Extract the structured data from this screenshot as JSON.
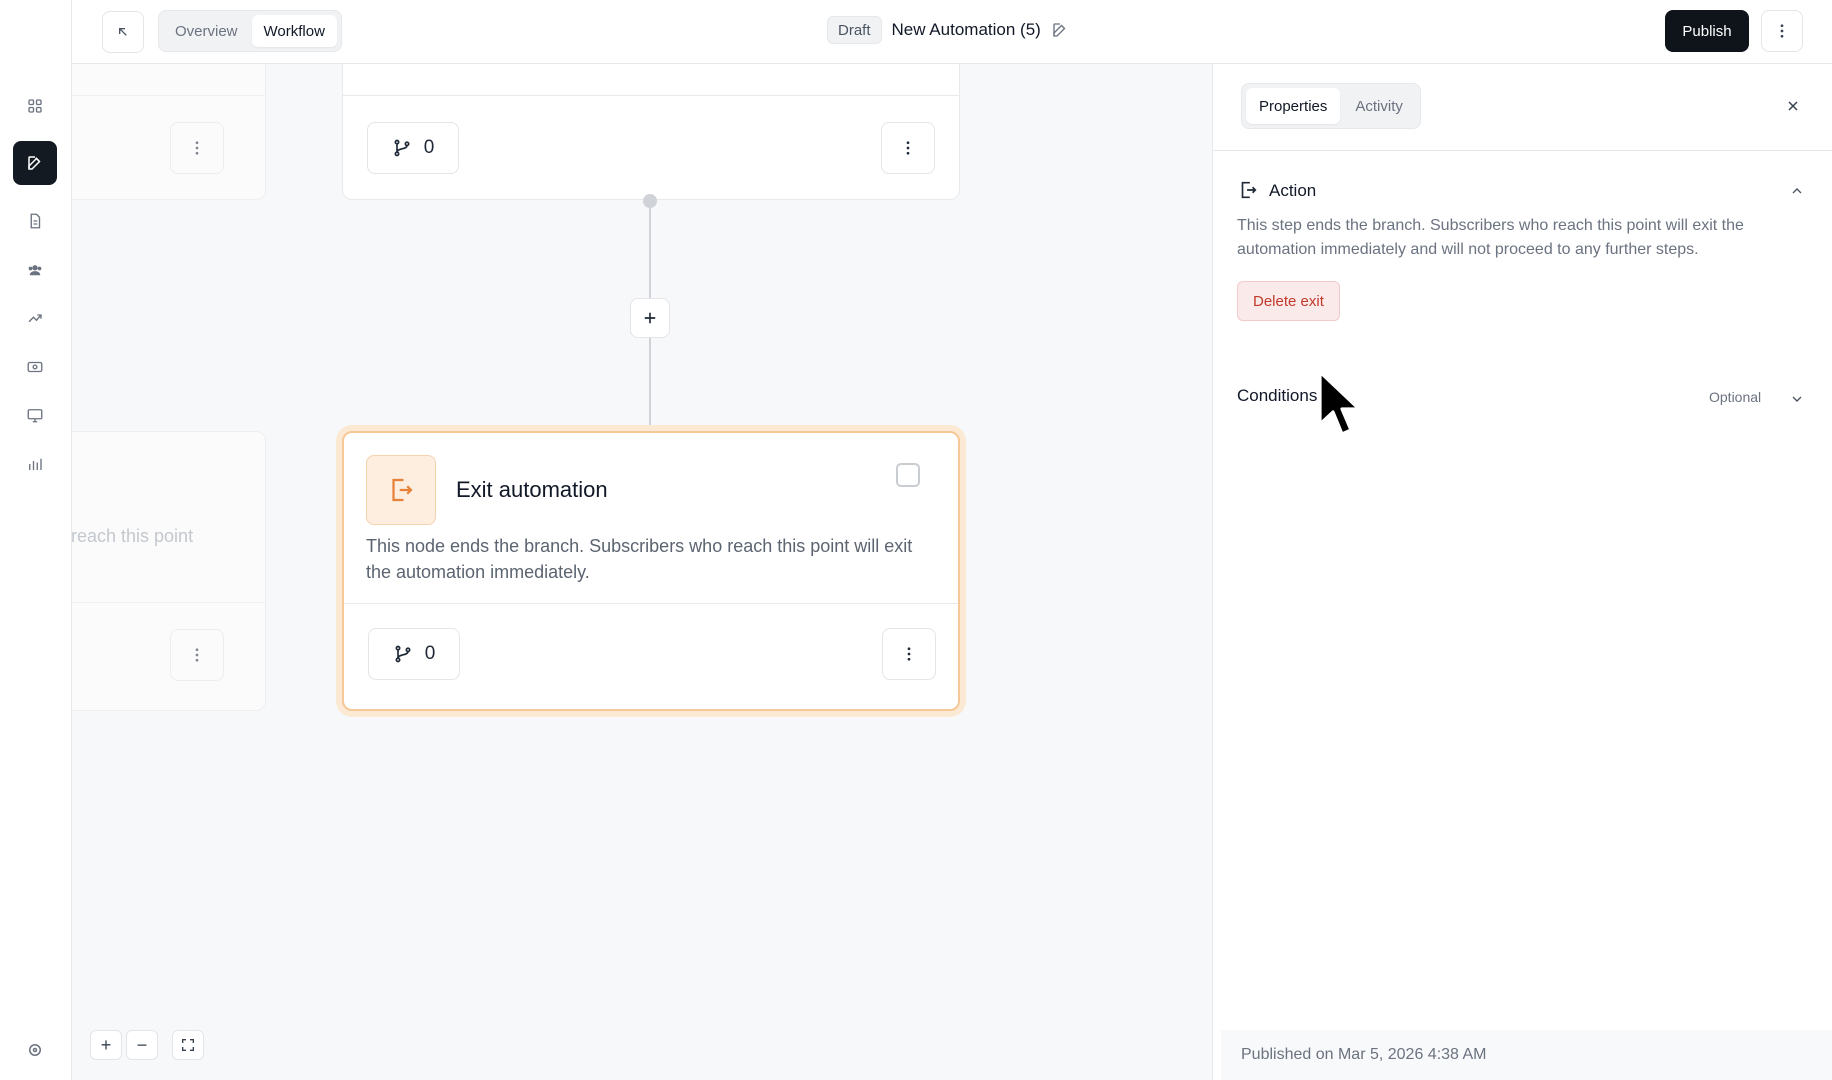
{
  "header": {
    "tabs": [
      {
        "label": "Overview",
        "active": false
      },
      {
        "label": "Workflow",
        "active": true
      }
    ],
    "status_badge": "Draft",
    "title": "New Automation (5)",
    "publish_label": "Publish"
  },
  "rail": {
    "items": [
      {
        "icon": "grid-icon",
        "active": false
      },
      {
        "icon": "edit-icon",
        "active": true
      },
      {
        "icon": "document-icon",
        "active": false
      },
      {
        "icon": "users-icon",
        "active": false
      },
      {
        "icon": "trend-icon",
        "active": false
      },
      {
        "icon": "money-icon",
        "active": false
      },
      {
        "icon": "monitor-icon",
        "active": false
      },
      {
        "icon": "bar-chart-icon",
        "active": false
      },
      {
        "icon": "settings-icon",
        "active": false
      }
    ]
  },
  "canvas": {
    "top_card": {
      "branch_count": "0"
    },
    "left_top_card": {},
    "left_bottom_card": {
      "partial_text": "reach this point"
    },
    "exit_card": {
      "title": "Exit automation",
      "description": "This node ends the branch. Subscribers who reach this point will exit the automation immediately.",
      "branch_count": "0"
    },
    "zoom_controls": {
      "zoom_in": "+",
      "zoom_out": "−"
    }
  },
  "panel": {
    "tabs": [
      {
        "label": "Properties",
        "active": true
      },
      {
        "label": "Activity",
        "active": false
      }
    ],
    "action": {
      "title": "Action",
      "description": "This step ends the branch. Subscribers who reach this point will exit the automation immediately and will not proceed to any further steps.",
      "delete_label": "Delete exit"
    },
    "conditions": {
      "title": "Conditions",
      "optional_label": "Optional"
    },
    "footer": "Published on Mar 5, 2026 4:38 AM"
  },
  "colors": {
    "accent_dark": "#0f141b",
    "exit_orange": "#e6823a",
    "danger": "#c0392b"
  }
}
